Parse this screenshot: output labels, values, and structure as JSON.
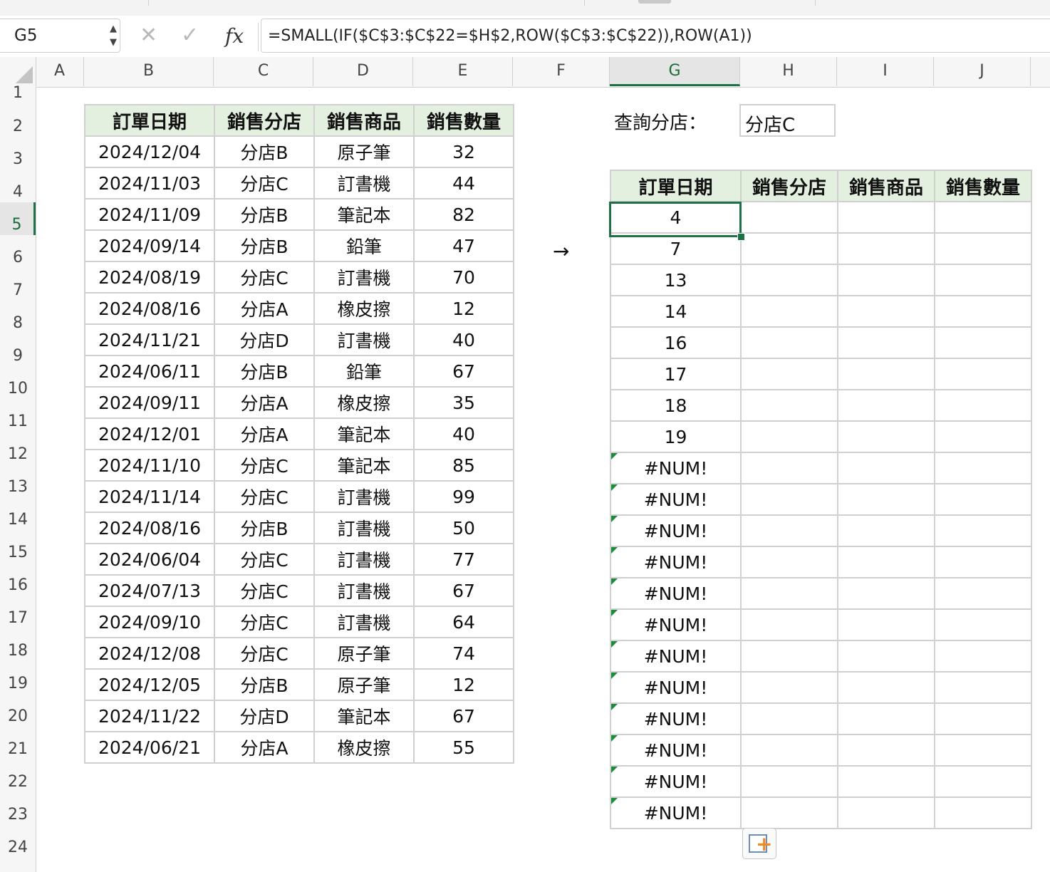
{
  "name_box": {
    "value": "G5"
  },
  "formula_bar": {
    "fx_label": "fx",
    "cancel_glyph": "✕",
    "confirm_glyph": "✓",
    "formula": "=SMALL(IF($C$3:$C$22=$H$2,ROW($C$3:$C$22)),ROW(A1))"
  },
  "columns": [
    "A",
    "B",
    "C",
    "D",
    "E",
    "F",
    "G",
    "H",
    "I",
    "J"
  ],
  "active_column": "G",
  "rows": [
    "1",
    "2",
    "3",
    "4",
    "5",
    "6",
    "7",
    "8",
    "9",
    "10",
    "11",
    "12",
    "13",
    "14",
    "15",
    "16",
    "17",
    "18",
    "19",
    "20",
    "21",
    "22",
    "23",
    "24"
  ],
  "active_row": "5",
  "source_table": {
    "headers": [
      "訂單日期",
      "銷售分店",
      "銷售商品",
      "銷售數量"
    ],
    "rows": [
      [
        "2024/12/04",
        "分店B",
        "原子筆",
        "32"
      ],
      [
        "2024/11/03",
        "分店C",
        "訂書機",
        "44"
      ],
      [
        "2024/11/09",
        "分店B",
        "筆記本",
        "82"
      ],
      [
        "2024/09/14",
        "分店B",
        "鉛筆",
        "47"
      ],
      [
        "2024/08/19",
        "分店C",
        "訂書機",
        "70"
      ],
      [
        "2024/08/16",
        "分店A",
        "橡皮擦",
        "12"
      ],
      [
        "2024/11/21",
        "分店D",
        "訂書機",
        "40"
      ],
      [
        "2024/06/11",
        "分店B",
        "鉛筆",
        "67"
      ],
      [
        "2024/09/11",
        "分店A",
        "橡皮擦",
        "35"
      ],
      [
        "2024/12/01",
        "分店A",
        "筆記本",
        "40"
      ],
      [
        "2024/11/10",
        "分店C",
        "筆記本",
        "85"
      ],
      [
        "2024/11/14",
        "分店C",
        "訂書機",
        "99"
      ],
      [
        "2024/08/16",
        "分店B",
        "訂書機",
        "50"
      ],
      [
        "2024/06/04",
        "分店C",
        "訂書機",
        "77"
      ],
      [
        "2024/07/13",
        "分店C",
        "訂書機",
        "67"
      ],
      [
        "2024/09/10",
        "分店C",
        "訂書機",
        "64"
      ],
      [
        "2024/12/08",
        "分店C",
        "原子筆",
        "74"
      ],
      [
        "2024/12/05",
        "分店B",
        "原子筆",
        "12"
      ],
      [
        "2024/11/22",
        "分店D",
        "筆記本",
        "67"
      ],
      [
        "2024/06/21",
        "分店A",
        "橡皮擦",
        "55"
      ]
    ]
  },
  "query": {
    "label": "查詢分店：",
    "value": "分店C"
  },
  "arrow": "→",
  "result_table": {
    "headers": [
      "訂單日期",
      "銷售分店",
      "銷售商品",
      "銷售數量"
    ],
    "values": [
      "4",
      "7",
      "13",
      "14",
      "16",
      "17",
      "18",
      "19",
      "#NUM!",
      "#NUM!",
      "#NUM!",
      "#NUM!",
      "#NUM!",
      "#NUM!",
      "#NUM!",
      "#NUM!",
      "#NUM!",
      "#NUM!",
      "#NUM!",
      "#NUM!"
    ]
  },
  "colors": {
    "accent": "#1e7145",
    "header_fill": "#e3efdf",
    "error_indicator": "#1e8a3c"
  }
}
